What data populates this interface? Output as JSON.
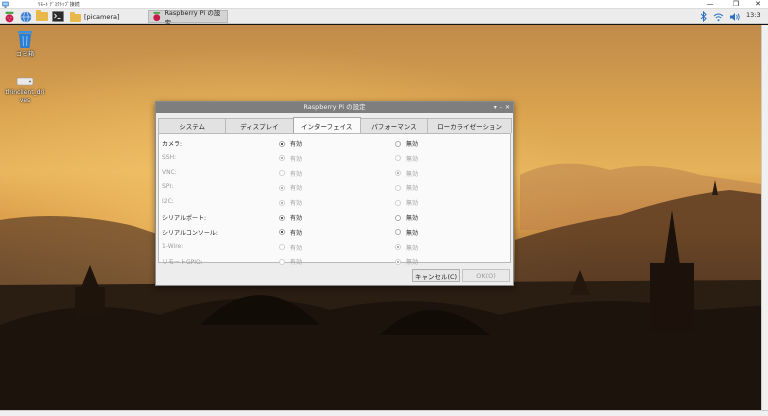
{
  "remote_window": {
    "title": "ﾘﾓｰﾄ ﾃﾞｽｸﾄｯﾌﾟ接続",
    "min_glyph": "—",
    "max_glyph": "❐",
    "close_glyph": "✕"
  },
  "taskbar": {
    "tasks": [
      {
        "label": "[picamera]"
      },
      {
        "label": "Raspberry Pi の設定"
      }
    ],
    "clock": "13:3"
  },
  "desktop": {
    "icons": [
      {
        "label": "ゴミ箱",
        "icon": "trash-icon"
      },
      {
        "label": "thinclient_drives",
        "icon": "drive-icon"
      }
    ]
  },
  "dialog": {
    "title": "Raspberry Pi の設定",
    "controls": [
      "▾",
      "-",
      "✕"
    ],
    "tabs": [
      {
        "label": "システム",
        "active": false
      },
      {
        "label": "ディスプレイ",
        "active": false
      },
      {
        "label": "インターフェイス",
        "active": true
      },
      {
        "label": "パフォーマンス",
        "active": false
      },
      {
        "label": "ローカライゼーション",
        "active": false
      }
    ],
    "enable_label": "有効",
    "disable_label": "無効",
    "rows": [
      {
        "label": "カメラ:",
        "value": "enabled",
        "disabled": false
      },
      {
        "label": "SSH:",
        "value": "enabled",
        "disabled": true
      },
      {
        "label": "VNC:",
        "value": "disabled",
        "disabled": true
      },
      {
        "label": "SPI:",
        "value": "enabled",
        "disabled": true
      },
      {
        "label": "I2C:",
        "value": "enabled",
        "disabled": true
      },
      {
        "label": "シリアルポート:",
        "value": "enabled",
        "disabled": false
      },
      {
        "label": "シリアルコンソール:",
        "value": "enabled",
        "disabled": false
      },
      {
        "label": "1-Wire:",
        "value": "disabled",
        "disabled": true
      },
      {
        "label": "リモートGPIO:",
        "value": "disabled",
        "disabled": true
      }
    ],
    "cancel_label": "キャンセル(C)",
    "ok_label": "OK(O)"
  },
  "colors": {
    "dialog_title_bar": "#7e7e7e",
    "sky_warm": "#e6b25a",
    "foreground_dark": "#221710"
  }
}
